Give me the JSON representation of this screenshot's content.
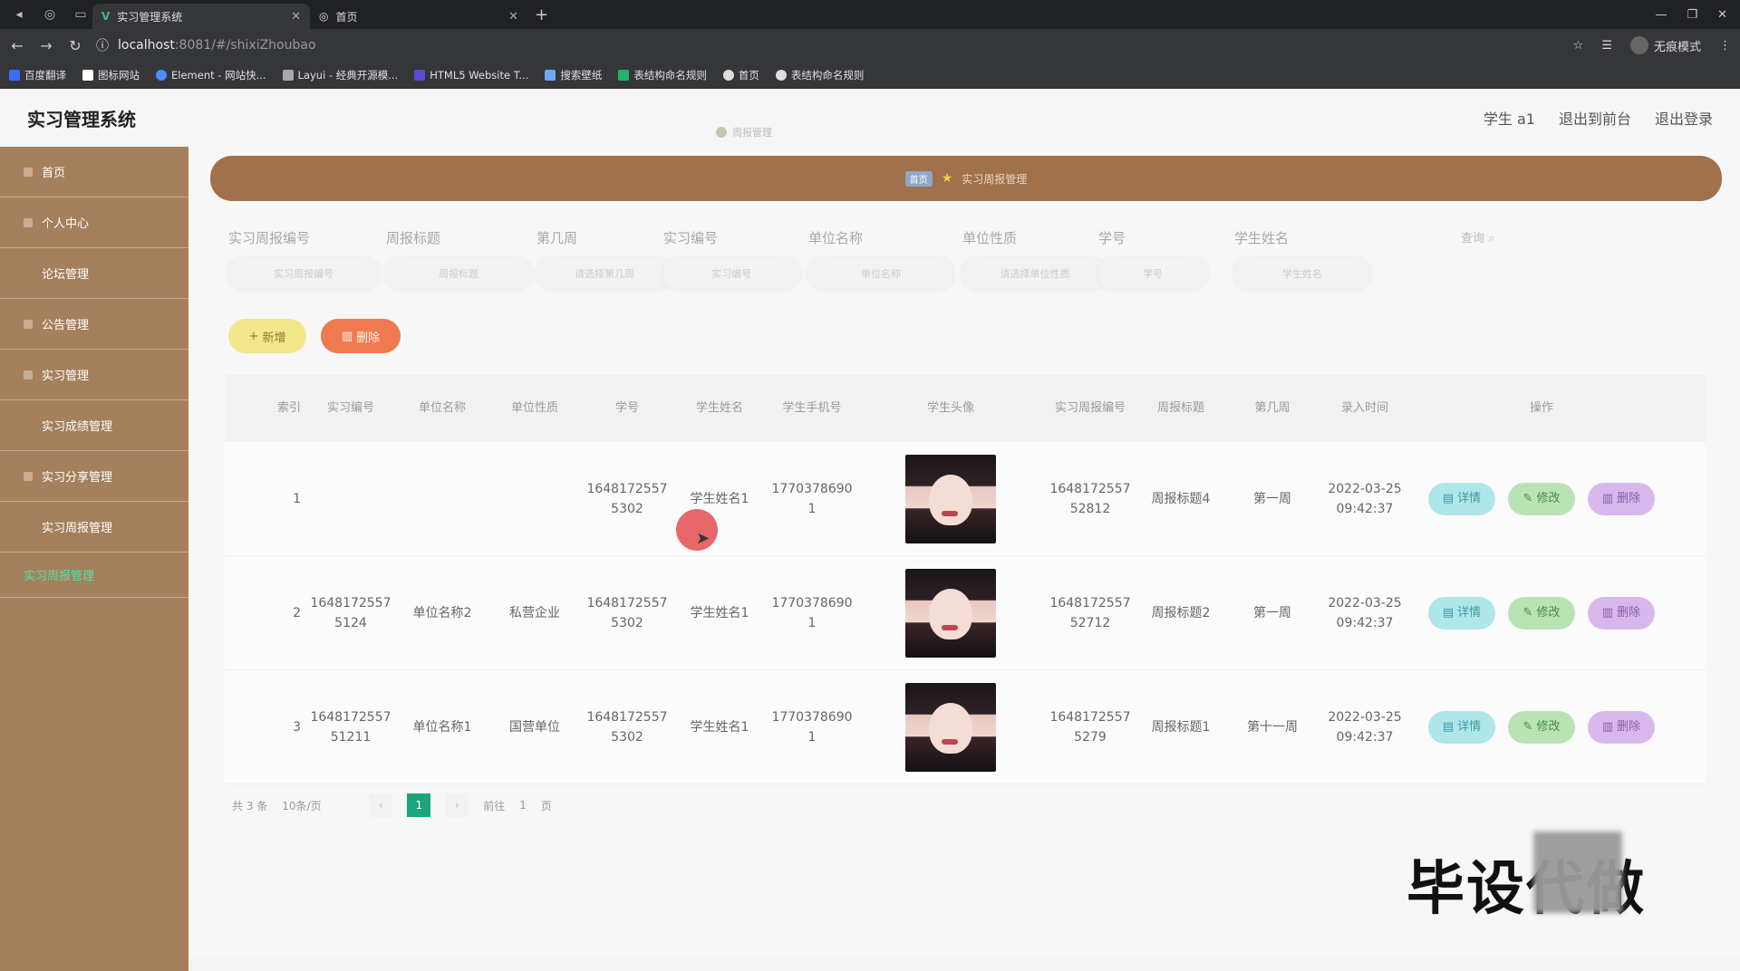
{
  "browser": {
    "tabs": [
      {
        "title": "实习管理系统",
        "active": true
      },
      {
        "title": "首页",
        "active": false
      }
    ],
    "url_host": "localhost",
    "url_rest": ":8081/#/shixiZhoubao",
    "incognito_label": "无痕模式",
    "bookmarks": [
      {
        "label": "百度翻译",
        "color": "#3b6cff"
      },
      {
        "label": "图标网站",
        "color": "#ffffff"
      },
      {
        "label": "Element - 网站快...",
        "color": "#4d8dff"
      },
      {
        "label": "Layui - 经典开源模...",
        "color": "#aaaaaa"
      },
      {
        "label": "HTML5 Website T...",
        "color": "#5b4bd6"
      },
      {
        "label": "搜索壁纸",
        "color": "#6fa7ff"
      },
      {
        "label": "表结构命名规则",
        "color": "#22b36b"
      },
      {
        "label": "首页",
        "color": "#dddddd"
      },
      {
        "label": "表结构命名规则",
        "color": "#dddddd"
      }
    ]
  },
  "header": {
    "title": "实习管理系统",
    "notice": "周报管理",
    "user": "学生 a1",
    "back_front": "退出到前台",
    "logout": "退出登录"
  },
  "sidebar": {
    "items": [
      {
        "label": "首页"
      },
      {
        "label": "个人中心"
      },
      {
        "label": "论坛管理"
      },
      {
        "label": "公告管理"
      },
      {
        "label": "实习管理"
      },
      {
        "label": "实习成绩管理"
      },
      {
        "label": "实习分享管理"
      },
      {
        "label": "实习周报管理"
      },
      {
        "label": "实习周报管理"
      }
    ]
  },
  "banner": {
    "crumb": "首页",
    "current": "实习周报管理"
  },
  "filters": [
    {
      "label": "实习周报编号",
      "placeholder": "实习周报编号"
    },
    {
      "label": "周报标题",
      "placeholder": "周报标题"
    },
    {
      "label": "第几周",
      "placeholder": "请选择第几周"
    },
    {
      "label": "实习编号",
      "placeholder": "实习编号"
    },
    {
      "label": "单位名称",
      "placeholder": "单位名称"
    },
    {
      "label": "单位性质",
      "placeholder": "请选择单位性质"
    },
    {
      "label": "学号",
      "placeholder": "学号"
    },
    {
      "label": "学生姓名",
      "placeholder": "学生姓名"
    }
  ],
  "query_label": "查询",
  "actions": {
    "add": "新增",
    "delete": "删除"
  },
  "table": {
    "headers": [
      "索引",
      "实习编号",
      "单位名称",
      "单位性质",
      "学号",
      "学生姓名",
      "学生手机号",
      "学生头像",
      "实习周报编号",
      "周报标题",
      "第几周",
      "录入时间",
      "操作"
    ],
    "rows": [
      {
        "index": "1",
        "shixi_no": "",
        "unit": "",
        "nature": "",
        "student_no": "16481725575302",
        "name": "学生姓名1",
        "phone": "1770378690 1",
        "weekly_no": "164817255752812",
        "title": "周报标题4",
        "week": "第一周",
        "time": "2022-03-25 09:42:37"
      },
      {
        "index": "2",
        "shixi_no": "16481725575124",
        "unit": "单位名称2",
        "nature": "私营企业",
        "student_no": "16481725575302",
        "name": "学生姓名1",
        "phone": "1770378690 1",
        "weekly_no": "164817255752712",
        "title": "周报标题2",
        "week": "第一周",
        "time": "2022-03-25 09:42:37"
      },
      {
        "index": "3",
        "shixi_no": "164817255751211",
        "unit": "单位名称1",
        "nature": "国营单位",
        "student_no": "16481725575302",
        "name": "学生姓名1",
        "phone": "1770378690 1",
        "weekly_no": "16481725575279",
        "title": "周报标题1",
        "week": "第十一周",
        "time": "2022-03-25 09:42:37"
      }
    ],
    "op_labels": {
      "detail": "详情",
      "edit": "修改",
      "delete": "删除"
    }
  },
  "pager": {
    "total": "共 3 条",
    "size": "10条/页",
    "current": "1",
    "goto_prefix": "前往",
    "goto_value": "1",
    "goto_suffix": "页"
  },
  "watermark": "毕设代做"
}
